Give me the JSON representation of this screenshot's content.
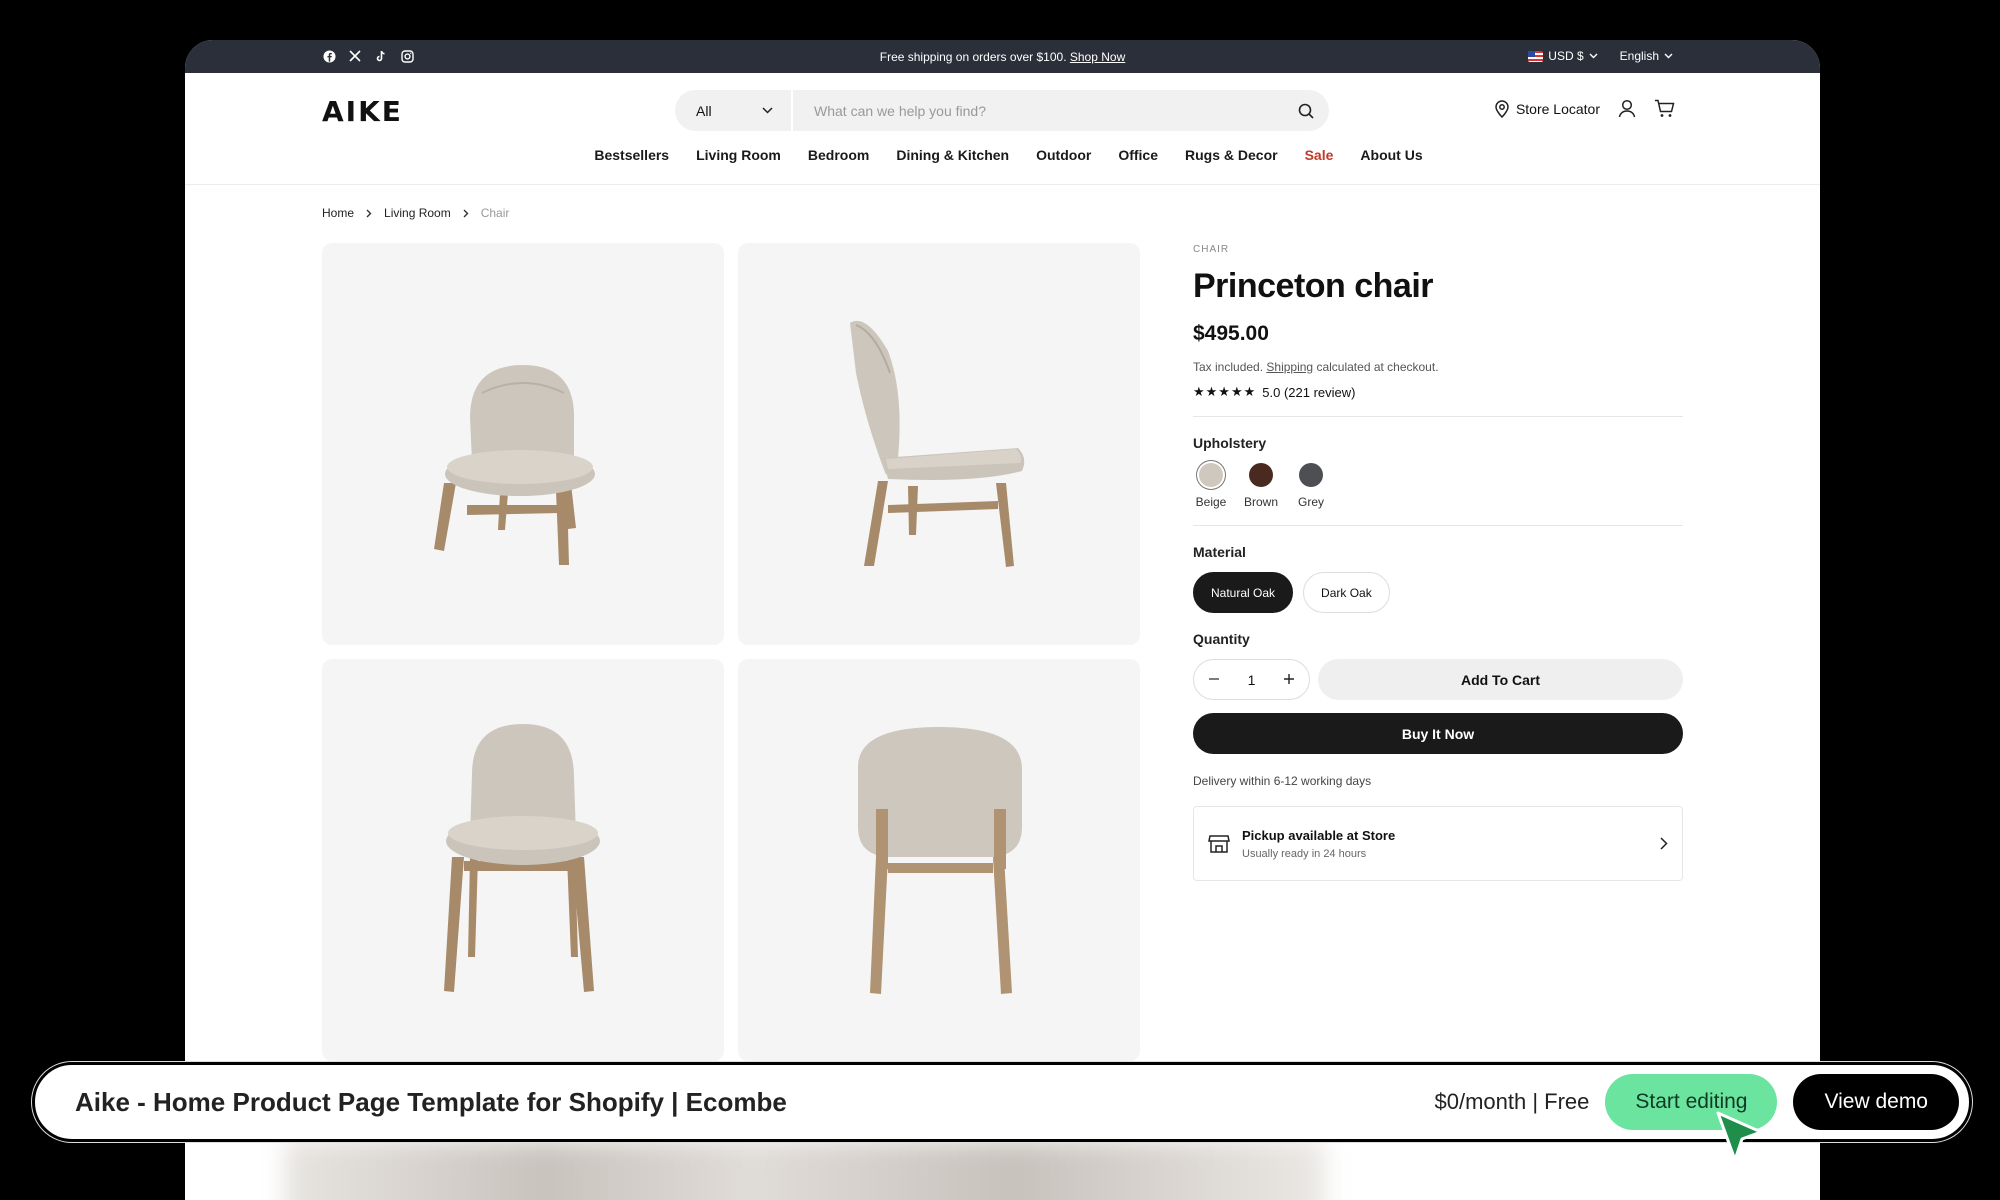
{
  "announcement": {
    "text": "Free shipping on orders over $100.",
    "link": "Shop Now",
    "currency": "USD $",
    "language": "English",
    "socials": [
      "facebook-icon",
      "x-icon",
      "tiktok-icon",
      "instagram-icon"
    ]
  },
  "header": {
    "logo": "AIKE",
    "search": {
      "category": "All",
      "placeholder": "What can we help you find?"
    },
    "store_locator": "Store Locator"
  },
  "nav": [
    "Bestsellers",
    "Living Room",
    "Bedroom",
    "Dining & Kitchen",
    "Outdoor",
    "Office",
    "Rugs & Decor",
    "Sale",
    "About Us"
  ],
  "breadcrumb": {
    "home": "Home",
    "section": "Living Room",
    "current": "Chair"
  },
  "product": {
    "kicker": "CHAIR",
    "title": "Princeton chair",
    "price": "$495.00",
    "tax_prefix": "Tax included.",
    "tax_link": "Shipping",
    "tax_suffix": "calculated at checkout.",
    "stars": "★★★★★",
    "rating": "5.0 (221 review)",
    "upholstery_label": "Upholstery",
    "upholstery": [
      {
        "name": "Beige",
        "color": "#cfc8be"
      },
      {
        "name": "Brown",
        "color": "#4a2a20"
      },
      {
        "name": "Grey",
        "color": "#4d4f52"
      }
    ],
    "material_label": "Material",
    "materials": [
      "Natural Oak",
      "Dark Oak"
    ],
    "quantity_label": "Quantity",
    "quantity": "1",
    "add_to_cart": "Add To Cart",
    "buy_now": "Buy It Now",
    "delivery": "Delivery within 6-12 working days",
    "pickup_title": "Pickup available at Store",
    "pickup_sub": "Usually ready in 24 hours"
  },
  "colors": {
    "upholstery_fabric": "#cdc6bd",
    "oak_wood": "#a88a69",
    "accent_green": "#6be4a0",
    "sale_red": "#c0392b"
  },
  "bottom_bar": {
    "title": "Aike - Home Product Page Template for Shopify | Ecombe",
    "price": "$0/month | Free",
    "start_editing": "Start editing",
    "view_demo": "View demo"
  }
}
